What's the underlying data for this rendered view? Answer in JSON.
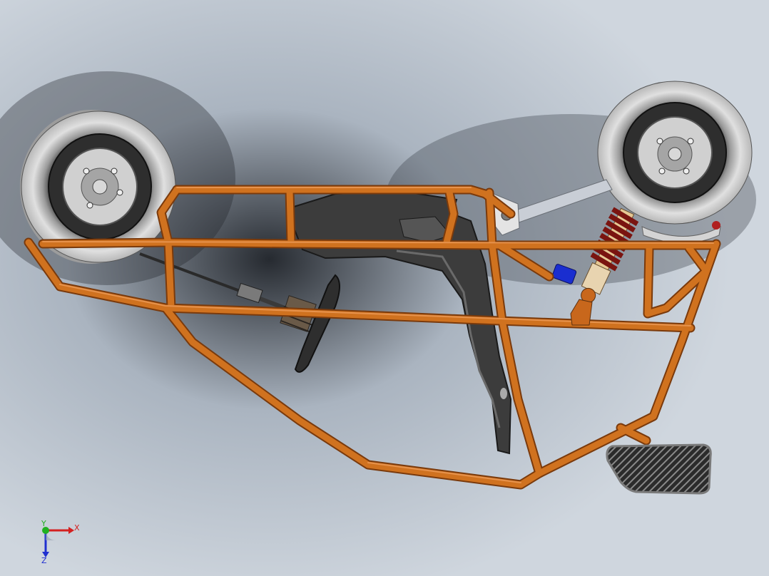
{
  "viewport": {
    "background_colors": {
      "light": "#cfd6de",
      "mid": "#aab4c0",
      "dark": "#262a30"
    }
  },
  "model": {
    "frame_color": "#c8671c",
    "frame_dark": "#7a3a0c",
    "tire_color": "#d8d8d8",
    "rim_color": "#3a3a3a",
    "hub_color": "#9a9a9a",
    "seat_color": "#3c3c3c",
    "spring_color": "#7a1410",
    "shock_body_color": "#e6c894",
    "blue_part_color": "#1a2ed0",
    "control_arm_color": "#c9ced6",
    "pedal_color": "#2b2b2b"
  },
  "triad": {
    "x_label": "X",
    "y_label": "Y",
    "z_label": "Z",
    "x_color": "#d42020",
    "y_color": "#20b020",
    "z_color": "#2030d0"
  }
}
